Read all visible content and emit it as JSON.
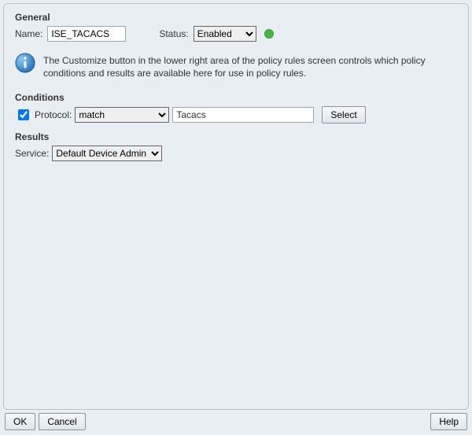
{
  "general": {
    "section_title": "General",
    "name_label": "Name:",
    "name_value": "ISE_TACACS",
    "status_label": "Status:",
    "status_value": "Enabled",
    "status_color": "#4bb543"
  },
  "info": {
    "icon_name": "info-icon",
    "text": "The Customize button in the lower right area of the policy rules screen controls which policy conditions and results are available here for use in policy rules."
  },
  "conditions": {
    "section_title": "Conditions",
    "protocol_checked": true,
    "protocol_label": "Protocol:",
    "operator_value": "match",
    "protocol_value": "Tacacs",
    "select_button": "Select"
  },
  "results": {
    "section_title": "Results",
    "service_label": "Service:",
    "service_value": "Default Device Admin"
  },
  "footer": {
    "ok": "OK",
    "cancel": "Cancel",
    "help": "Help"
  }
}
